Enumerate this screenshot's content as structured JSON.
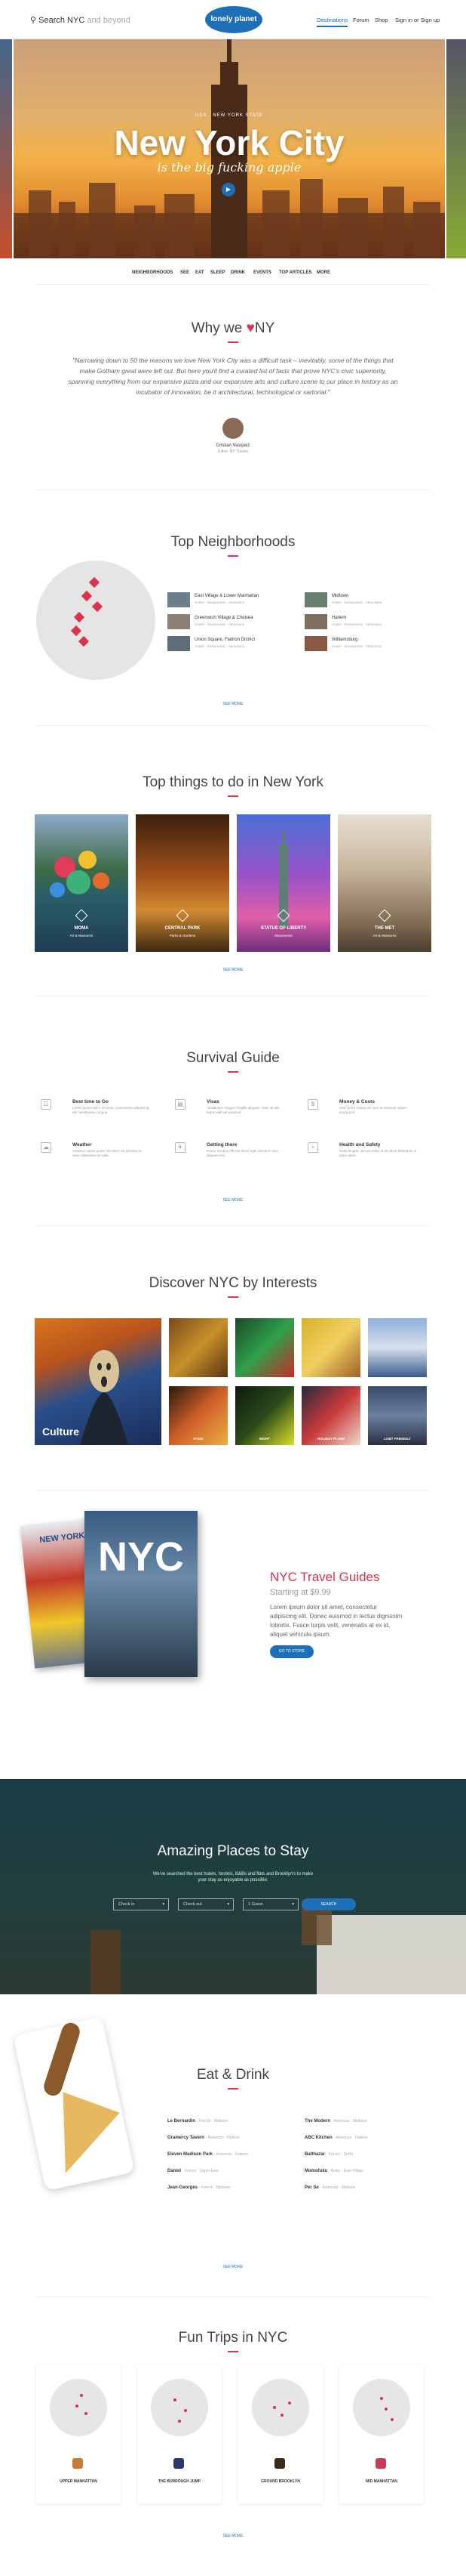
{
  "header": {
    "search_label": "Search NYC",
    "search_placeholder": "and beyond",
    "logo": "lonely planet",
    "nav": [
      "Destinations",
      "Forum",
      "Shop",
      "Sign in or Sign up"
    ]
  },
  "hero": {
    "kicker": "USA · NEW YORK STATE",
    "title": "New York City",
    "subtitle": "is the big fucking apple"
  },
  "subnav": [
    "NEIGHBORHOODS",
    "SEE",
    "EAT",
    "SLEEP",
    "DRINK",
    "EVENTS",
    "TOP ARTICLES",
    "MORE"
  ],
  "why": {
    "title": "Why we",
    "title_suffix": "NY",
    "quote": "\"Narrowing down to 50 the reasons we love New York City was a difficult task – inevitably, some of the things that make Gotham great were left out. But here you'll find a curated list of facts that prove NYC's civic superiority, spanning everything from our expansive pizza and our expansive arts and culture scene to our place in history as an incubator of innovation, be it architectural, technological or sartorial.\"",
    "author": "Cristian Vasquez",
    "author_role": "Editor, NY Travels"
  },
  "neighborhoods": {
    "title": "Top Neighborhoods",
    "items": [
      {
        "name": "East Village & Lower Manhattan",
        "meta": "Hotels · Restaurants · Attractions"
      },
      {
        "name": "Greenwich Village & Chelsea",
        "meta": "Hotels · Restaurants · Attractions"
      },
      {
        "name": "Union Square, Flatiron District",
        "meta": "Hotels · Restaurants · Attractions"
      },
      {
        "name": "Midtown",
        "meta": "Hotels · Restaurants · Attractions"
      },
      {
        "name": "Harlem",
        "meta": "Hotels · Restaurants · Attractions"
      },
      {
        "name": "Williamsburg",
        "meta": "Hotels · Restaurants · Attractions"
      }
    ],
    "see_more": "SEE MORE"
  },
  "things": {
    "title": "Top things to do in New York",
    "items": [
      {
        "name": "MOMA",
        "sub": "Art & Museums"
      },
      {
        "name": "CENTRAL PARK",
        "sub": "Parks & Gardens"
      },
      {
        "name": "STATUE OF LIBERTY",
        "sub": "Monuments"
      },
      {
        "name": "THE MET",
        "sub": "Art & Museums"
      }
    ],
    "see_more": "SEE MORE"
  },
  "survival": {
    "title": "Survival Guide",
    "items": [
      {
        "title": "Best time to Go",
        "desc": "Lorem ipsum dolor sit amet, consectetur adipiscing elit. Vestibulum congue."
      },
      {
        "title": "Visas",
        "desc": "Vestibulum congue fringilla aliquam. Nam iaculis turpis velit vel euismod."
      },
      {
        "title": "Money & Costs",
        "desc": "Nam porta massa vel sem at euismod sapien suscipit et."
      },
      {
        "title": "Weather",
        "desc": "Vivamus varius quam, tincidunt vel pulvinar ac, vitae, bibendum at nulla."
      },
      {
        "title": "Getting there",
        "desc": "Donec tempus efficitur lacus eget interdum sem aliquam nisl."
      },
      {
        "title": "Health and Safety",
        "desc": "Nulla feugiat, ultrices tellus et tincidunt bibendum et dolor amet."
      }
    ],
    "see_more": "SEE MORE"
  },
  "interests": {
    "title": "Discover NYC by Interests",
    "featured": "Culture",
    "items": [
      "",
      "",
      "",
      "",
      "",
      "FOOD",
      "NIGHT",
      "HOLIDAY PLANS",
      "LGBT FRIENDLY"
    ]
  },
  "guides": {
    "book_title": "NEW YORK CITY",
    "book_big": "NYC",
    "title": "NYC Travel Guides",
    "price": "Starting at $9.99",
    "desc": "Lorem ipsum dolor sit amet, consectetur adipiscing elit. Donec euismod in lectus dignissim lobortis. Fusce turpis velit, venenatis at ex id, aliquet vehicula ipsum.",
    "button": "GO TO STORE"
  },
  "stay": {
    "title": "Amazing Places to Stay",
    "desc": "We've searched the best hotels, hostels, B&Bs and flats and Brooklyn's to make your stay as enjoyable as possible.",
    "fields": [
      "Check in",
      "Check out",
      "1 Guest"
    ],
    "button": "SEARCH"
  },
  "eat": {
    "title": "Eat & Drink",
    "left": [
      {
        "name": "Le Bernardin",
        "meta": "· French · Midtown"
      },
      {
        "name": "Gramercy Tavern",
        "meta": "· American · Flatiron"
      },
      {
        "name": "Eleven Madison Park",
        "meta": "· American · Flatiron"
      },
      {
        "name": "Daniel",
        "meta": "· French · Upper East"
      },
      {
        "name": "Jean-Georges",
        "meta": "· French · Midtown"
      }
    ],
    "right": [
      {
        "name": "The Modern",
        "meta": "· American · Midtown"
      },
      {
        "name": "ABC Kitchen",
        "meta": "· American · Flatiron"
      },
      {
        "name": "Balthazar",
        "meta": "· French · SoHo"
      },
      {
        "name": "Momofuku",
        "meta": "· Asian · East Village"
      },
      {
        "name": "Per Se",
        "meta": "· American · Midtown"
      }
    ],
    "see_more": "SEE MORE"
  },
  "trips": {
    "title": "Fun Trips in NYC",
    "items": [
      "UPPER MANHATTAN",
      "THE BURROUGH JUMP",
      "GROUND BROOKLYN",
      "MID MANHATTAN"
    ],
    "see_more": "SEE MORE"
  },
  "colors": {
    "accent": "#1d6fb8",
    "heart": "#d9344b"
  }
}
